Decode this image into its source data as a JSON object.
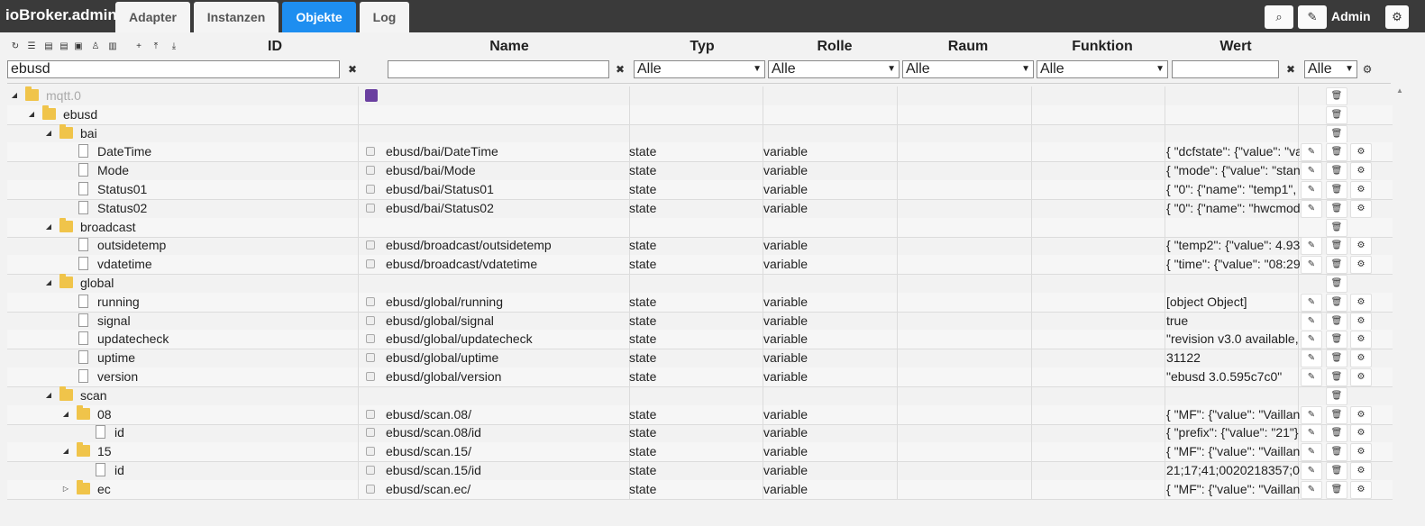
{
  "app": {
    "title": "ioBroker.admin"
  },
  "tabs": [
    {
      "label": "Adapter"
    },
    {
      "label": "Instanzen"
    },
    {
      "label": "Objekte"
    },
    {
      "label": "Log"
    }
  ],
  "user": {
    "name": "Admin"
  },
  "icons": {
    "search": "⌕",
    "edit": "✎",
    "settings": "⚙",
    "refresh": "↻",
    "delete": "🗑",
    "clear": "✖"
  },
  "columns": {
    "id": "ID",
    "name": "Name",
    "type": "Typ",
    "role": "Rolle",
    "room": "Raum",
    "function": "Funktion",
    "value": "Wert"
  },
  "filters": {
    "id_value": "ebusd",
    "name_value": "",
    "type_value": "Alle",
    "role_value": "Alle",
    "room_value": "Alle",
    "function_value": "Alle",
    "value_value": "",
    "ack_value": "Alle"
  },
  "rows": [
    {
      "level": 0,
      "kind": "folder",
      "toggle": "◢",
      "id": "mqtt.0",
      "name": "",
      "type": "",
      "role": "",
      "value": "",
      "muted": true,
      "rss": true,
      "actions": "delete"
    },
    {
      "level": 1,
      "kind": "folder",
      "toggle": "◢",
      "id": "ebusd",
      "name": "",
      "type": "",
      "role": "",
      "value": "",
      "actions": "delete"
    },
    {
      "level": 2,
      "kind": "folder",
      "toggle": "◢",
      "id": "bai",
      "name": "",
      "type": "",
      "role": "",
      "value": "",
      "actions": "delete"
    },
    {
      "level": 3,
      "kind": "file",
      "id": "DateTime",
      "name": "ebusd/bai/DateTime",
      "type": "state",
      "role": "variable",
      "value": "{ \"dcfstate\": {\"value\": \"va",
      "actions": "all"
    },
    {
      "level": 3,
      "kind": "file",
      "id": "Mode",
      "name": "ebusd/bai/Mode",
      "type": "state",
      "role": "variable",
      "value": "{ \"mode\": {\"value\": \"stan",
      "actions": "all"
    },
    {
      "level": 3,
      "kind": "file",
      "id": "Status01",
      "name": "ebusd/bai/Status01",
      "type": "state",
      "role": "variable",
      "value": "{ \"0\": {\"name\": \"temp1\",",
      "actions": "all"
    },
    {
      "level": 3,
      "kind": "file",
      "id": "Status02",
      "name": "ebusd/bai/Status02",
      "type": "state",
      "role": "variable",
      "value": "{ \"0\": {\"name\": \"hwcmod",
      "actions": "all"
    },
    {
      "level": 2,
      "kind": "folder",
      "toggle": "◢",
      "id": "broadcast",
      "name": "",
      "type": "",
      "role": "",
      "value": "",
      "actions": "delete"
    },
    {
      "level": 3,
      "kind": "file",
      "id": "outsidetemp",
      "name": "ebusd/broadcast/outsidetemp",
      "type": "state",
      "role": "variable",
      "value": "{ \"temp2\": {\"value\": 4.93",
      "actions": "all"
    },
    {
      "level": 3,
      "kind": "file",
      "id": "vdatetime",
      "name": "ebusd/broadcast/vdatetime",
      "type": "state",
      "role": "variable",
      "value": "{ \"time\": {\"value\": \"08:29",
      "actions": "all"
    },
    {
      "level": 2,
      "kind": "folder",
      "toggle": "◢",
      "id": "global",
      "name": "",
      "type": "",
      "role": "",
      "value": "",
      "actions": "delete"
    },
    {
      "level": 3,
      "kind": "file",
      "id": "running",
      "name": "ebusd/global/running",
      "type": "state",
      "role": "variable",
      "value": "[object Object]",
      "actions": "all"
    },
    {
      "level": 3,
      "kind": "file",
      "id": "signal",
      "name": "ebusd/global/signal",
      "type": "state",
      "role": "variable",
      "value": "true",
      "actions": "all"
    },
    {
      "level": 3,
      "kind": "file",
      "id": "updatecheck",
      "name": "ebusd/global/updatecheck",
      "type": "state",
      "role": "variable",
      "value": "\"revision v3.0 available,",
      "actions": "all"
    },
    {
      "level": 3,
      "kind": "file",
      "id": "uptime",
      "name": "ebusd/global/uptime",
      "type": "state",
      "role": "variable",
      "value": "31122",
      "actions": "all"
    },
    {
      "level": 3,
      "kind": "file",
      "id": "version",
      "name": "ebusd/global/version",
      "type": "state",
      "role": "variable",
      "value": "\"ebusd 3.0.595c7c0\"",
      "actions": "all"
    },
    {
      "level": 2,
      "kind": "folder",
      "toggle": "◢",
      "id": "scan",
      "name": "",
      "type": "",
      "role": "",
      "value": "",
      "actions": "delete"
    },
    {
      "level": 3,
      "kind": "folder",
      "toggle": "◢",
      "id": "08",
      "name": "ebusd/scan.08/",
      "type": "state",
      "role": "variable",
      "value": "{ \"MF\": {\"value\": \"Vaillan",
      "actions": "all"
    },
    {
      "level": 4,
      "kind": "file",
      "id": "id",
      "name": "ebusd/scan.08/id",
      "type": "state",
      "role": "variable",
      "value": "{ \"prefix\": {\"value\": \"21\"}",
      "actions": "all"
    },
    {
      "level": 3,
      "kind": "folder",
      "toggle": "◢",
      "id": "15",
      "name": "ebusd/scan.15/",
      "type": "state",
      "role": "variable",
      "value": "{ \"MF\": {\"value\": \"Vaillan",
      "actions": "all"
    },
    {
      "level": 4,
      "kind": "file",
      "id": "id",
      "name": "ebusd/scan.15/id",
      "type": "state",
      "role": "variable",
      "value": "21;17;41;0020218357;0",
      "actions": "all"
    },
    {
      "level": 3,
      "kind": "folder",
      "toggle": "▷",
      "id": "ec",
      "name": "ebusd/scan.ec/",
      "type": "state",
      "role": "variable",
      "value": "{ \"MF\": {\"value\": \"Vaillan",
      "actions": "all"
    }
  ]
}
